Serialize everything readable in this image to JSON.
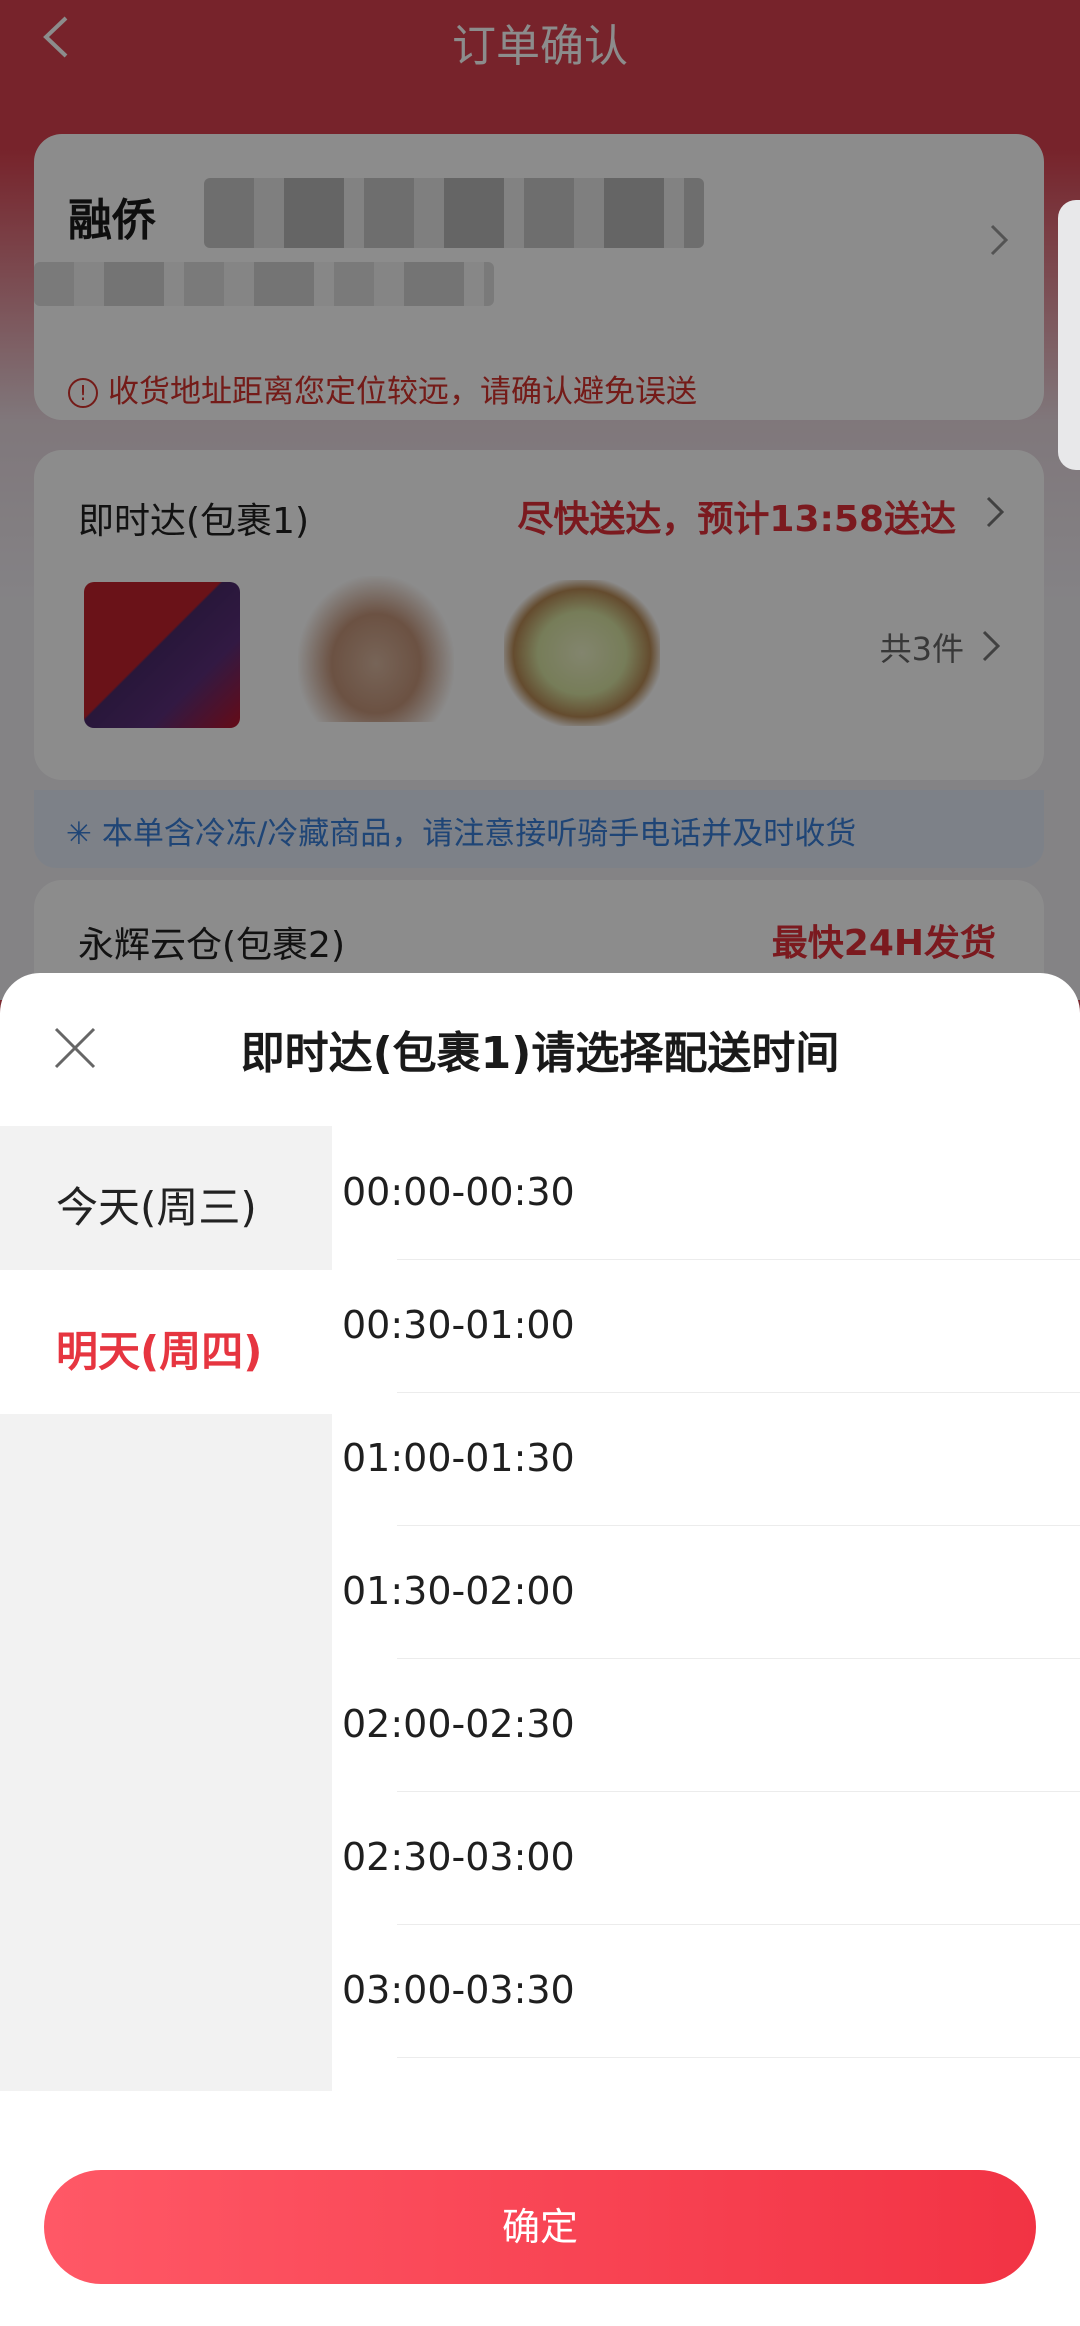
{
  "header": {
    "title": "订单确认"
  },
  "address": {
    "name_visible": "融侨",
    "warning": "收货地址距离您定位较远，请确认避免误送"
  },
  "package1": {
    "label": "即时达(包裹1)",
    "eta": "尽快送达，预计13:58送达",
    "item_count": "共3件",
    "cold_notice": "本单含冷冻/冷藏商品，请注意接听骑手电话并及时收货"
  },
  "package2": {
    "label": "永辉云仓(包裹2)",
    "eta": "最快24H发货"
  },
  "sheet": {
    "title": "即时达(包裹1)请选择配送时间",
    "days": [
      {
        "label": "今天(周三)"
      },
      {
        "label": "明天(周四)",
        "selected": true
      }
    ],
    "slots": [
      "00:00-00:30",
      "00:30-01:00",
      "01:00-01:30",
      "01:30-02:00",
      "02:00-02:30",
      "02:30-03:00",
      "03:00-03:30"
    ],
    "confirm_label": "确定"
  },
  "colors": {
    "accent": "#e63540",
    "info": "#3a7ed8"
  },
  "icons": {
    "back": "back-arrow-icon",
    "chevron": "chevron-right-icon",
    "close": "close-icon",
    "warning": "warning-icon",
    "snowflake": "snowflake-icon"
  }
}
